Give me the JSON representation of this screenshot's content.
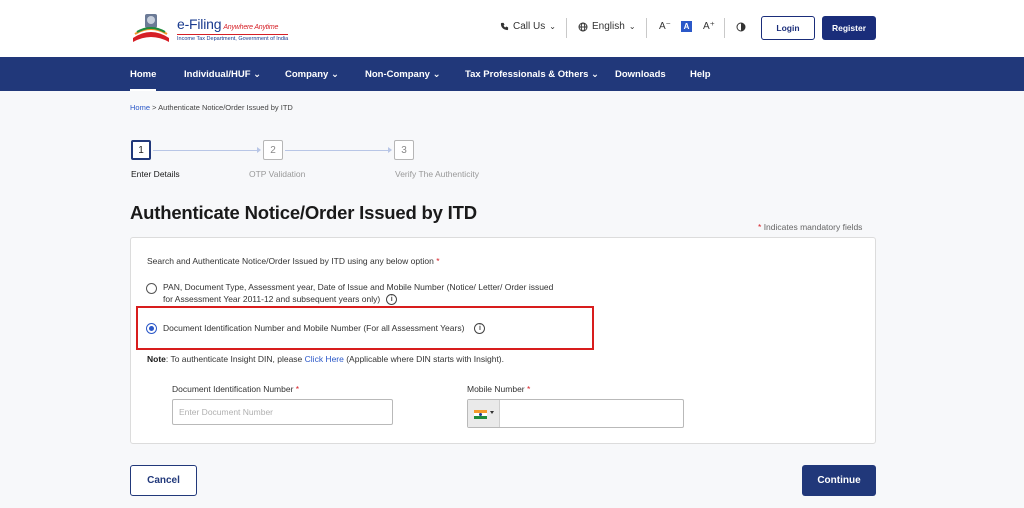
{
  "header": {
    "logo_title": "e-Filing",
    "logo_tagline": "Anywhere Anytime",
    "logo_subtitle": "Income Tax Department, Government of India",
    "call_us": "Call Us",
    "language": "English",
    "font_decrease": "A⁻",
    "font_normal": "A",
    "font_increase": "A⁺",
    "login": "Login",
    "register": "Register"
  },
  "nav": {
    "items": [
      "Home",
      "Individual/HUF",
      "Company",
      "Non-Company",
      "Tax Professionals & Others",
      "Downloads",
      "Help"
    ]
  },
  "breadcrumb": {
    "home": "Home",
    "separator": ">",
    "current": "Authenticate Notice/Order Issued by ITD"
  },
  "stepper": {
    "steps": [
      {
        "number": "1",
        "label": "Enter Details",
        "active": true
      },
      {
        "number": "2",
        "label": "OTP Validation",
        "active": false
      },
      {
        "number": "3",
        "label": "Verify The Authenticity",
        "active": false
      }
    ]
  },
  "page": {
    "title": "Authenticate Notice/Order Issued by ITD",
    "mandatory_note": "Indicates mandatory fields",
    "required_marker": "*"
  },
  "form": {
    "intro": "Search and Authenticate Notice/Order Issued by ITD using any below option",
    "option1_line1": "PAN, Document Type, Assessment year, Date of Issue and Mobile Number (Notice/ Letter/ Order issued",
    "option1_line2": "for Assessment Year 2011-12 and subsequent years only)",
    "option2": "Document Identification Number and Mobile Number (For all Assessment Years)",
    "selected_option": 2,
    "note_label": "Note",
    "note_text": ": To authenticate Insight DIN, please ",
    "note_link": "Click Here",
    "note_suffix": " (Applicable where DIN starts with Insight).",
    "din_label": "Document Identification Number",
    "din_placeholder": "Enter Document Number",
    "mobile_label": "Mobile Number"
  },
  "actions": {
    "cancel": "Cancel",
    "continue": "Continue"
  },
  "colors": {
    "primary": "#21387a",
    "accent": "#2b58c8",
    "required": "#d61f26",
    "highlight": "#d81d1d"
  }
}
